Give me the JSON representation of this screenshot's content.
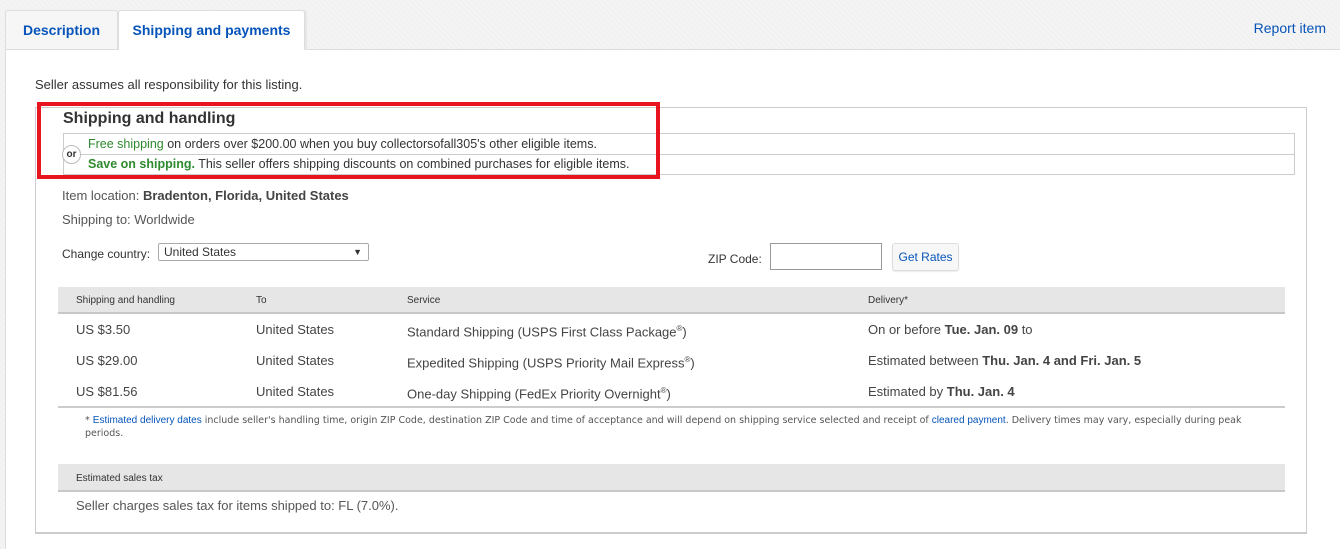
{
  "tabs": [
    {
      "label": "Description",
      "active": false
    },
    {
      "label": "Shipping and payments",
      "active": true
    }
  ],
  "report_item": "Report item",
  "responsibility": "Seller assumes all responsibility for this listing.",
  "shipping_handling": {
    "title": "Shipping and handling",
    "or_label": "or",
    "offers": [
      {
        "highlight": "Free shipping",
        "text": " on orders over $200.00 when you buy collectorsofall305's other eligible items."
      },
      {
        "highlight": "Save on shipping.",
        "text": " This seller offers shipping discounts on combined purchases for eligible items."
      }
    ]
  },
  "item_location": {
    "label": "Item location: ",
    "value": "Bradenton, Florida, United States"
  },
  "shipping_to": "Shipping to: Worldwide",
  "country": {
    "label": "Change country:",
    "selected": "United States",
    "arrow": "▼"
  },
  "zip": {
    "label": "ZIP Code:",
    "value": "",
    "button": "Get Rates"
  },
  "rates_table": {
    "headers": [
      "Shipping and handling",
      "To",
      "Service",
      "Delivery*"
    ],
    "rows": [
      {
        "price": "US $3.50",
        "to": "United States",
        "service": "Standard Shipping (USPS First Class Package",
        "service_mark": "®",
        "service_end": ")",
        "delivery_pre": "On or before ",
        "delivery_bold": "Tue. Jan. 09",
        "delivery_post": " to"
      },
      {
        "price": "US $29.00",
        "to": "United States",
        "service": "Expedited Shipping (USPS Priority Mail Express",
        "service_mark": "®",
        "service_end": ")",
        "delivery_pre": "Estimated between ",
        "delivery_bold": "Thu. Jan. 4 and Fri. Jan. 5",
        "delivery_post": ""
      },
      {
        "price": "US $81.56",
        "to": "United States",
        "service": "One-day Shipping (FedEx Priority Overnight",
        "service_mark": "®",
        "service_end": ")",
        "delivery_pre": "Estimated by ",
        "delivery_bold": "Thu. Jan. 4",
        "delivery_post": ""
      }
    ]
  },
  "footnote": {
    "star": "* ",
    "link1": "Estimated delivery dates",
    "text1": " include seller's handling time, origin ZIP Code, destination ZIP Code and time of acceptance and will depend on shipping service selected and receipt of ",
    "link2": "cleared payment",
    "text2": ". Delivery times may vary, especially during peak periods."
  },
  "sales_tax": {
    "header": "Estimated sales tax",
    "text": "Seller charges sales tax for items shipped to: FL (7.0%)."
  },
  "colors": {
    "link": "#0654ba",
    "green": "#2e8a2e",
    "highlight_border": "#e8141f"
  }
}
